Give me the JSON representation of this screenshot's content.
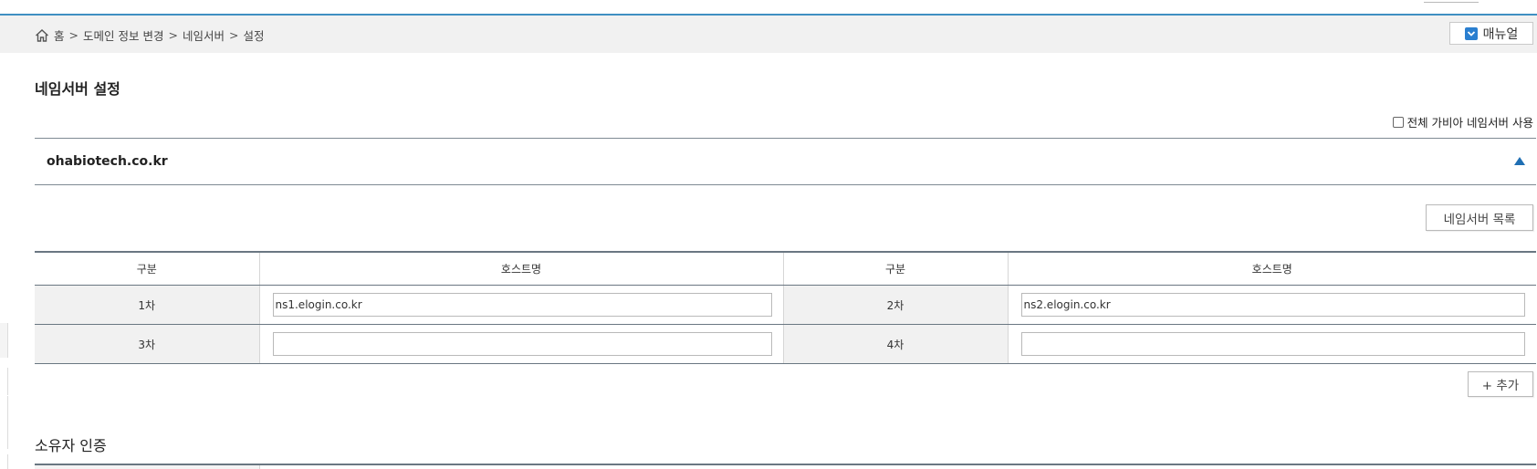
{
  "breadcrumb": {
    "home_label": "홈",
    "separator": ">",
    "items": [
      "도메인 정보 변경",
      "네임서버",
      "설정"
    ]
  },
  "manual_button": {
    "label": "매뉴얼",
    "icon": "chevron-down-icon",
    "icon_color": "#2a7fd0"
  },
  "page_title": "네임서버 설정",
  "all_gabia_ns_option": {
    "label": "전체 가비아 네임서버 사용",
    "checked": false
  },
  "domain": {
    "name": "ohabiotech.co.kr",
    "expanded": true,
    "toggle_icon": "triangle-up-icon",
    "accent_color": "#1f6fb3"
  },
  "ns_list_button": {
    "label": "네임서버 목록"
  },
  "ns_table": {
    "headers": [
      "구분",
      "호스트명",
      "구분",
      "호스트명"
    ],
    "rows": [
      {
        "left_label": "1차",
        "left_value": "ns1.elogin.co.kr",
        "left_placeholder": "",
        "right_label": "2차",
        "right_value": "ns2.elogin.co.kr",
        "right_placeholder": ""
      },
      {
        "left_label": "3차",
        "left_value": "",
        "left_placeholder": "",
        "right_label": "4차",
        "right_value": "",
        "right_placeholder": ""
      }
    ]
  },
  "add_button": {
    "label": "+ 추가"
  },
  "owner_section": {
    "title": "소유자 인증"
  },
  "colors": {
    "top_border": "#3f8fc2",
    "breadcrumb_bg": "#f1f1f1",
    "table_border": "#6a7782"
  }
}
